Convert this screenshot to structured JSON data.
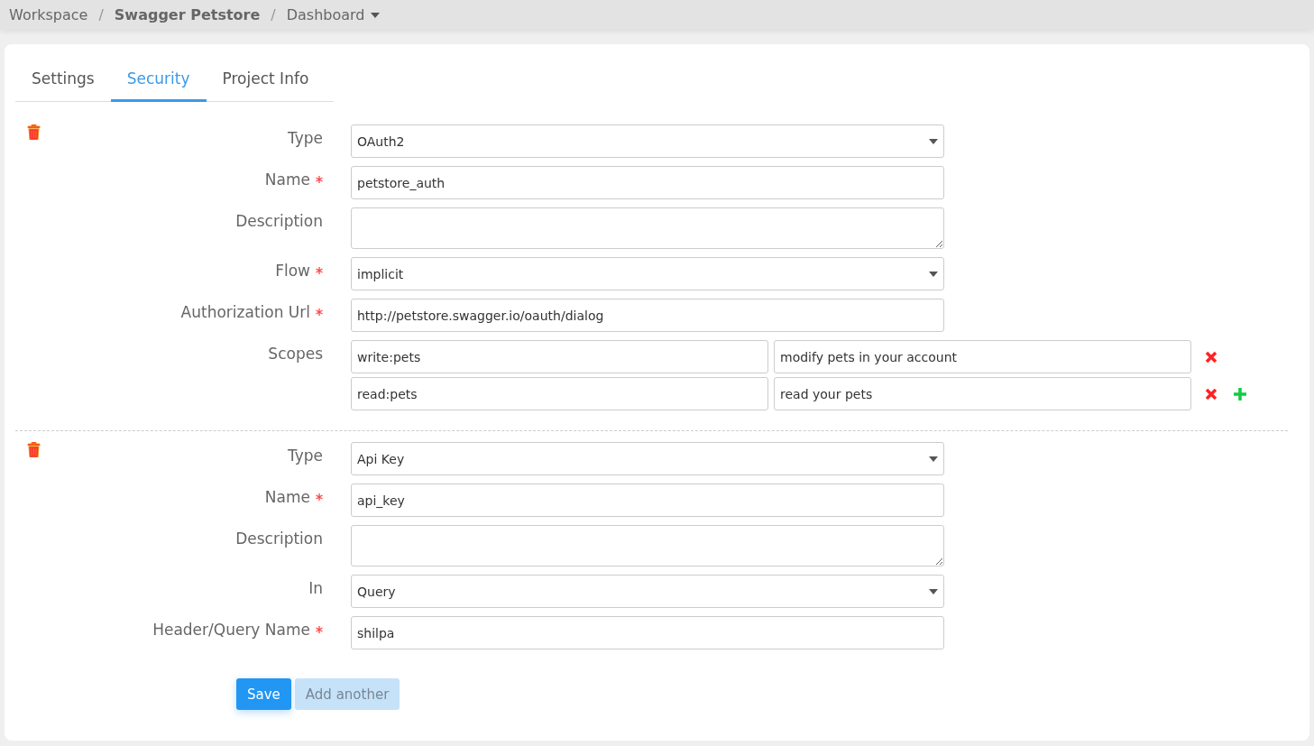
{
  "breadcrumb": {
    "separator": "/",
    "items": [
      {
        "label": "Workspace",
        "current": false
      },
      {
        "label": "Swagger Petstore",
        "current": true
      },
      {
        "label": "Dashboard",
        "current": false,
        "dropdown": true
      }
    ]
  },
  "tabs": [
    {
      "label": "Settings",
      "selected": false
    },
    {
      "label": "Security",
      "selected": true
    },
    {
      "label": "Project Info",
      "selected": false
    }
  ],
  "schemes": [
    {
      "fields": [
        {
          "label": "Type",
          "kind": "select",
          "required": false,
          "value": "OAuth2"
        },
        {
          "label": "Name",
          "kind": "text",
          "required": true,
          "value": "petstore_auth"
        },
        {
          "label": "Description",
          "kind": "textarea",
          "required": false
        },
        {
          "label": "Flow",
          "kind": "select",
          "required": true,
          "value": "implicit"
        },
        {
          "label": "Authorization Url",
          "kind": "text",
          "required": true,
          "value": "http://petstore.swagger.io/oauth/dialog"
        },
        {
          "label": "Scopes",
          "kind": "scopes",
          "required": false,
          "scopes": [
            {
              "name": "write:pets",
              "description": "modify pets in your account"
            },
            {
              "name": "read:pets",
              "description": "read your pets"
            }
          ]
        }
      ]
    },
    {
      "fields": [
        {
          "label": "Type",
          "kind": "select",
          "required": false,
          "value": "Api Key"
        },
        {
          "label": "Name",
          "kind": "text",
          "required": true,
          "value": "api_key"
        },
        {
          "label": "Description",
          "kind": "textarea",
          "required": false
        },
        {
          "label": "In",
          "kind": "select",
          "required": false,
          "value": "Query"
        },
        {
          "label": "Header/Query Name",
          "kind": "text",
          "required": true,
          "value": "shilpa"
        }
      ]
    }
  ],
  "buttons": [
    {
      "label": "Save",
      "kind": "primary",
      "disabled": false
    },
    {
      "label": "Add another",
      "kind": "secondary",
      "disabled": true
    }
  ]
}
